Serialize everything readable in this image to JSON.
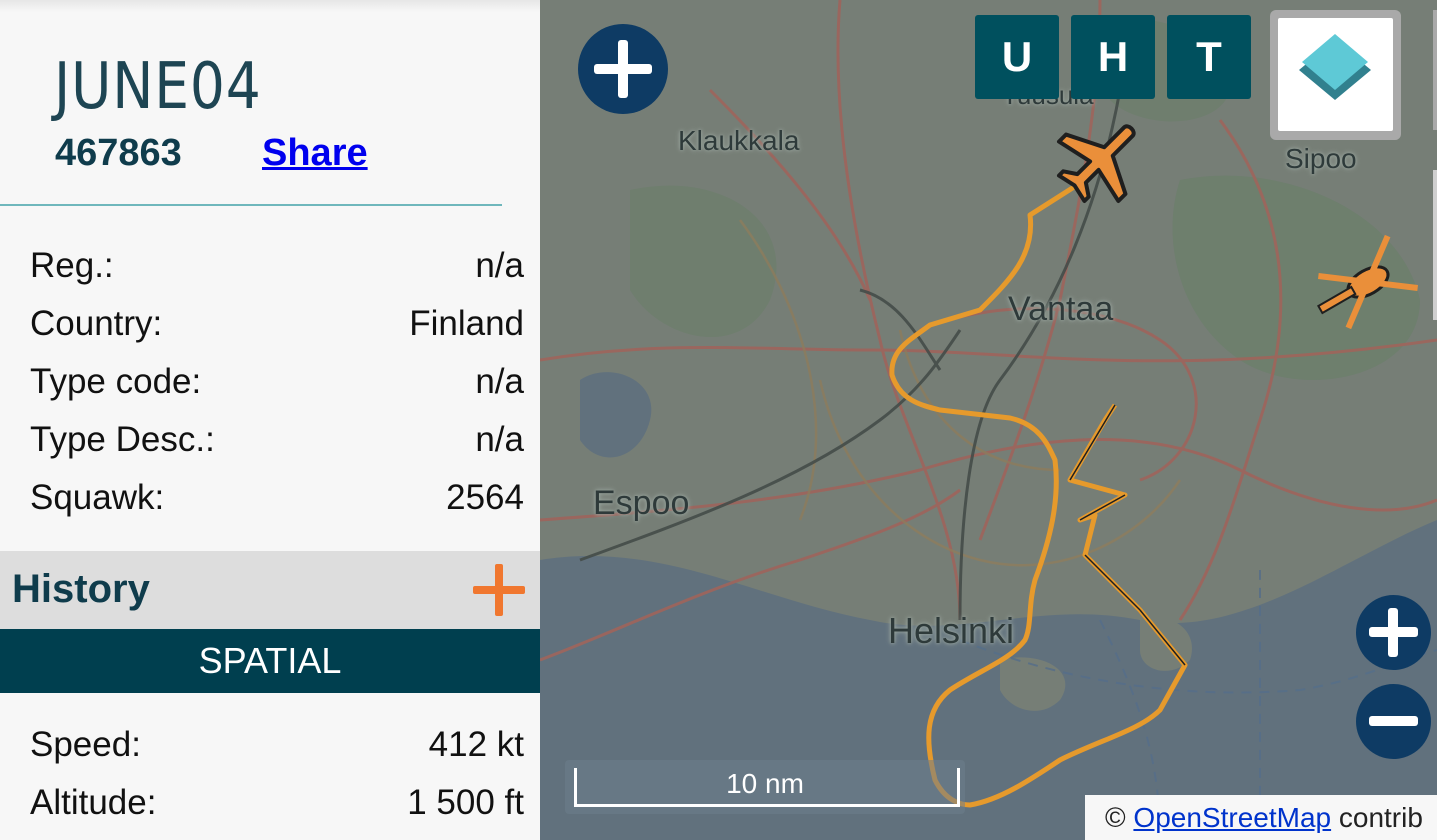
{
  "aircraft": {
    "callsign": "JUNE04",
    "hex": "467863",
    "share_label": "Share"
  },
  "details": [
    {
      "label": "Reg.:",
      "value": "n/a"
    },
    {
      "label": "Country:",
      "value": "Finland"
    },
    {
      "label": "Type code:",
      "value": "n/a"
    },
    {
      "label": "Type Desc.:",
      "value": "n/a"
    },
    {
      "label": "Squawk:",
      "value": "2564"
    }
  ],
  "history": {
    "title": "History",
    "tab": "SPATIAL"
  },
  "spatial": [
    {
      "label": "Speed:",
      "value": "412 kt"
    },
    {
      "label": "Altitude:",
      "value": "1 500 ft"
    }
  ],
  "map": {
    "place_labels": [
      "Tuusula",
      "Klaukkala",
      "Sipoo",
      "Vantaa",
      "Espoo",
      "Helsinki"
    ],
    "toggle_buttons": [
      "U",
      "H",
      "T"
    ],
    "scale_label": "10 nm",
    "attribution_prefix": "©",
    "attribution_link": "OpenStreetMap",
    "attribution_suffix": "contrib",
    "track_color": "#f39c1f",
    "aircraft_color": "#f7902f"
  }
}
